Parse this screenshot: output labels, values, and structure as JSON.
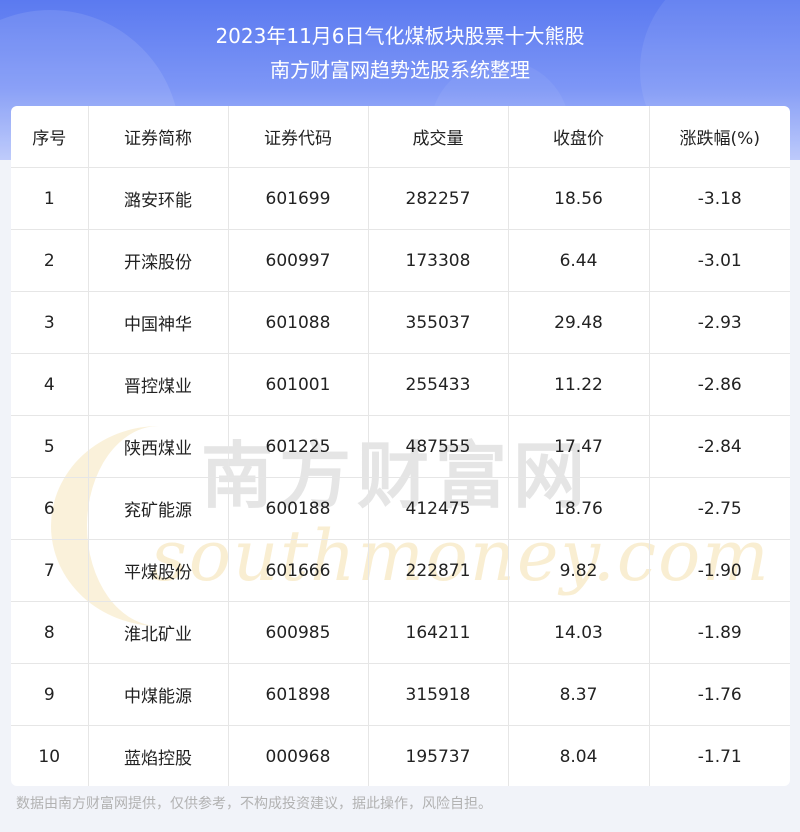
{
  "header": {
    "title": "2023年11月6日气化煤板块股票十大熊股",
    "subtitle": "南方财富网趋势选股系统整理"
  },
  "table": {
    "columns": [
      "序号",
      "证券简称",
      "证券代码",
      "成交量",
      "收盘价",
      "涨跌幅(%)"
    ],
    "rows": [
      [
        "1",
        "潞安环能",
        "601699",
        "282257",
        "18.56",
        "-3.18"
      ],
      [
        "2",
        "开滦股份",
        "600997",
        "173308",
        "6.44",
        "-3.01"
      ],
      [
        "3",
        "中国神华",
        "601088",
        "355037",
        "29.48",
        "-2.93"
      ],
      [
        "4",
        "晋控煤业",
        "601001",
        "255433",
        "11.22",
        "-2.86"
      ],
      [
        "5",
        "陕西煤业",
        "601225",
        "487555",
        "17.47",
        "-2.84"
      ],
      [
        "6",
        "兖矿能源",
        "600188",
        "412475",
        "18.76",
        "-2.75"
      ],
      [
        "7",
        "平煤股份",
        "601666",
        "222871",
        "9.82",
        "-1.90"
      ],
      [
        "8",
        "淮北矿业",
        "600985",
        "164211",
        "14.03",
        "-1.89"
      ],
      [
        "9",
        "中煤能源",
        "601898",
        "315918",
        "8.37",
        "-1.76"
      ],
      [
        "10",
        "蓝焰控股",
        "000968",
        "195737",
        "8.04",
        "-1.71"
      ]
    ]
  },
  "watermark": {
    "cn": "南方财富网",
    "en": "southmoney.com"
  },
  "footer": {
    "disclaimer": "数据由南方财富网提供，仅供参考，不构成投资建议，据此操作，风险自担。"
  }
}
